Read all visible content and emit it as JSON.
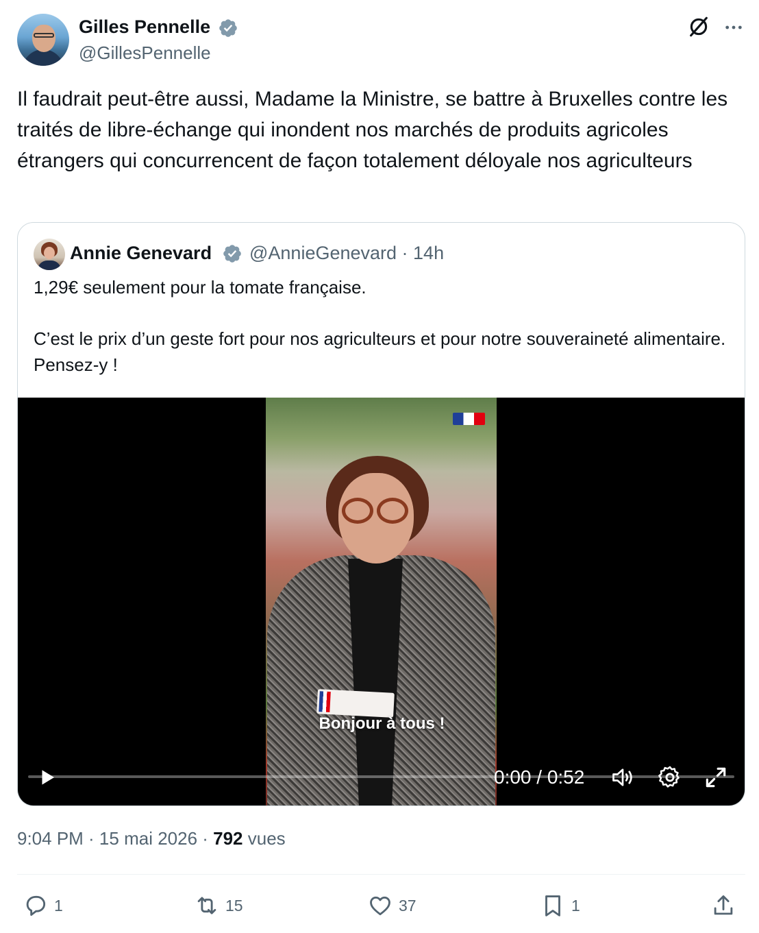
{
  "tweet": {
    "author": {
      "name": "Gilles Pennelle",
      "handle": "@GillesPennelle"
    },
    "text": "Il faudrait peut-être aussi, Madame la Ministre, se battre à Bruxelles contre les traités de libre-échange qui inondent nos marchés de produits agricoles étrangers qui concurrencent de façon totalement déloyale nos agriculteurs",
    "timestamp": "9:04 PM · 15 mai 2026 · ",
    "views_count": "792",
    "views_label": " vues"
  },
  "quote": {
    "author": {
      "name": "Annie Genevard",
      "handle": "@AnnieGenevard · 14h"
    },
    "text_line1": "1,29€ seulement pour la tomate française.",
    "text_line2": "C’est le prix d’un geste fort pour nos agriculteurs et pour notre souveraineté alimentaire. Pensez-y !",
    "video": {
      "subtitle": "Bonjour à tous !",
      "time": "0:00 / 0:52",
      "progress": 0
    }
  },
  "actions": {
    "replies": "1",
    "retweets": "15",
    "likes": "37",
    "bookmarks": "1"
  },
  "icons": {
    "verified": "verified-badge-icon",
    "grok": "grok-icon",
    "more": "more-icon",
    "reply": "reply-icon",
    "retweet": "retweet-icon",
    "like": "heart-icon",
    "bookmark": "bookmark-icon",
    "share": "share-icon",
    "play": "play-icon",
    "volume": "volume-icon",
    "settings": "gear-icon",
    "fullscreen": "fullscreen-icon"
  },
  "colors": {
    "verified": "#1d9bf0",
    "secondary_text": "#536471",
    "primary_text": "#0f1419"
  }
}
